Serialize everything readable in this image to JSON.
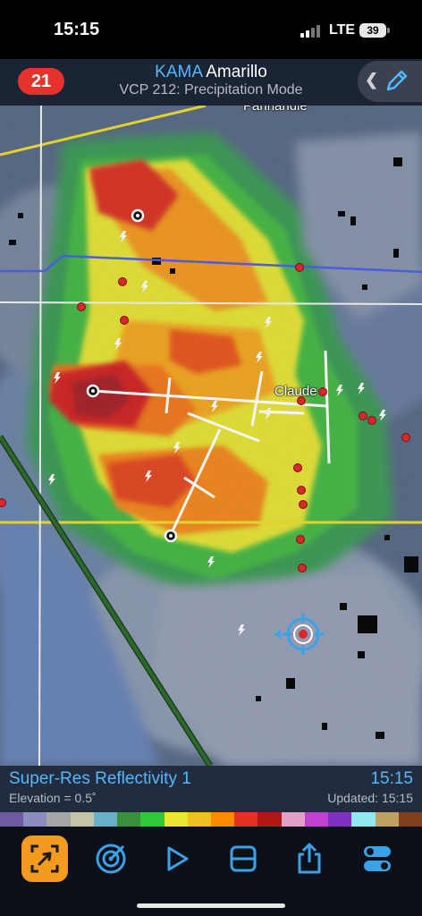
{
  "status_bar": {
    "time": "15:15",
    "network": "LTE",
    "battery": "39"
  },
  "header": {
    "alert_count": "21",
    "station_code": "KAMA",
    "station_name": "Amarillo",
    "vcp_mode": "VCP 212: Precipitation Mode",
    "icons": [
      "chevron-left-icon",
      "pencil-icon"
    ]
  },
  "map": {
    "place_labels": [
      "Panhandle",
      "Claude"
    ],
    "colors": {
      "road_yellow": "#e2d22e",
      "road_white": "#f0f0f0",
      "county_line_blue": "#4a5de0",
      "railroad_green": "#2c6a2c",
      "storm_report_red": "#d8272d",
      "user_location_blue": "#3aa3e8"
    }
  },
  "info_bar": {
    "product": "Super-Res Reflectivity 1",
    "elevation": "Elevation = 0.5˚",
    "scan_time": "15:15",
    "updated": "Updated: 15:15"
  },
  "color_scale": [
    "#6e5aa0",
    "#8a8dbd",
    "#a6a6a6",
    "#c4c4a8",
    "#68b0c8",
    "#3a8f3a",
    "#2ec83a",
    "#e8e830",
    "#f0c020",
    "#ff8a00",
    "#e63022",
    "#b01818",
    "#e0a0c8",
    "#c040d0",
    "#8030c0",
    "#90e8f0",
    "#c0a060",
    "#804020"
  ],
  "toolbar": {
    "tools": [
      "crop-select-icon",
      "radar-target-icon",
      "play-icon",
      "split-view-icon",
      "share-icon",
      "settings-toggle-icon"
    ],
    "active_tool": "crop-select-icon",
    "accent": "#f39a1f"
  }
}
